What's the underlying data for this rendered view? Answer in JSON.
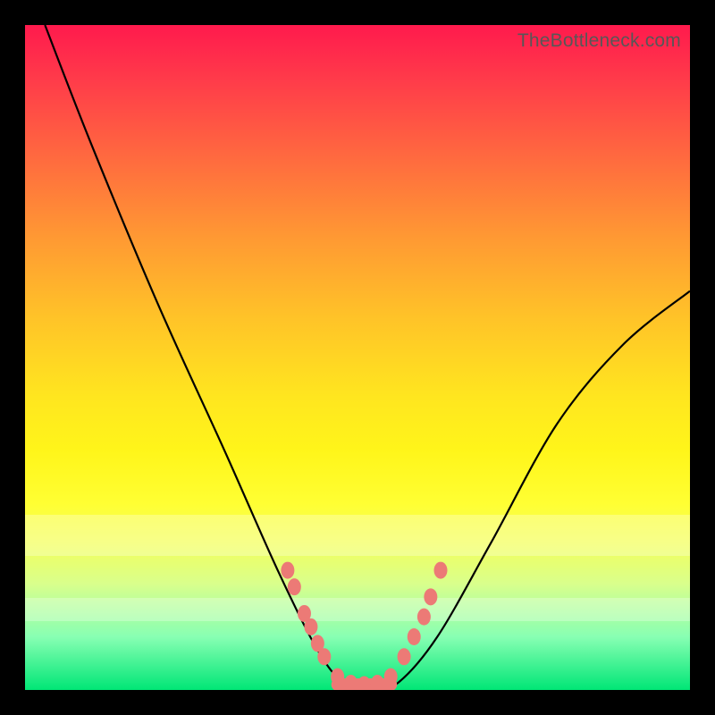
{
  "watermark": "TheBottleneck.com",
  "colors": {
    "dot": "#ec7a76",
    "curve": "#000000"
  },
  "chart_data": {
    "type": "line",
    "title": "",
    "xlabel": "",
    "ylabel": "",
    "xlim": [
      0,
      100
    ],
    "ylim": [
      0,
      100
    ],
    "series": [
      {
        "name": "bottleneck-curve",
        "x": [
          3,
          10,
          20,
          30,
          38,
          44,
          48,
          52,
          56,
          62,
          70,
          80,
          90,
          100
        ],
        "y": [
          100,
          82,
          58,
          36,
          18,
          6,
          1,
          0,
          1,
          8,
          22,
          40,
          52,
          60
        ]
      }
    ],
    "markers": {
      "name": "highlighted-points",
      "x": [
        39.5,
        40.5,
        42,
        43,
        44,
        45,
        47,
        49,
        51,
        53,
        55,
        57,
        58.5,
        60,
        61,
        62.5
      ],
      "y": [
        18,
        15.5,
        11.5,
        9.5,
        7,
        5,
        2,
        1,
        0.8,
        1,
        2,
        5,
        8,
        11,
        14,
        18
      ]
    },
    "bottom_bar": {
      "x_start": 47,
      "x_end": 55,
      "y": 0.8
    }
  }
}
